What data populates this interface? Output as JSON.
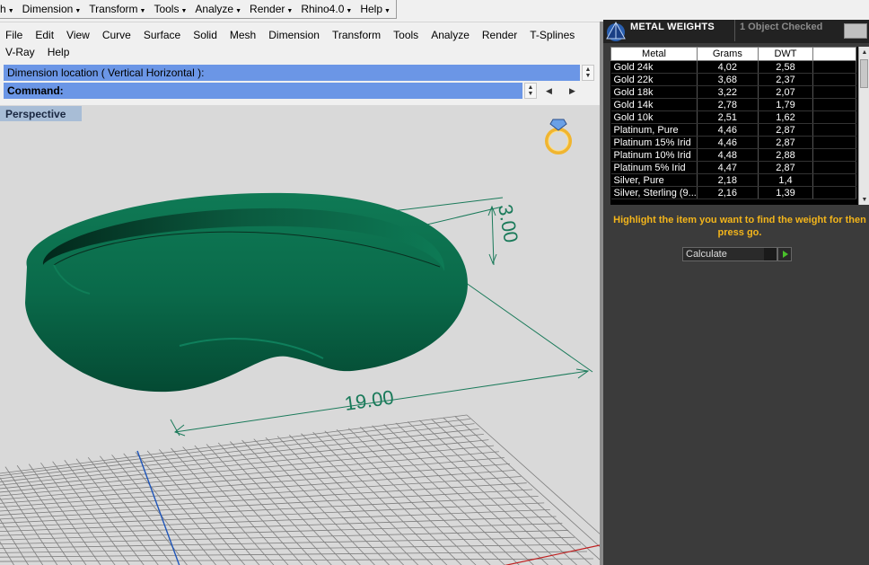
{
  "toolbar": {
    "items": [
      {
        "label": "h"
      },
      {
        "label": "Dimension"
      },
      {
        "label": "Transform"
      },
      {
        "label": "Tools"
      },
      {
        "label": "Analyze"
      },
      {
        "label": "Render"
      },
      {
        "label": "Rhino4.0"
      },
      {
        "label": "Help"
      }
    ]
  },
  "menubar": {
    "row1": [
      "File",
      "Edit",
      "View",
      "Curve",
      "Surface",
      "Solid",
      "Mesh",
      "Dimension",
      "Transform",
      "Tools",
      "Analyze",
      "Render",
      "T-Splines"
    ],
    "row2": [
      "V-Ray",
      "Help"
    ]
  },
  "command": {
    "history": "Dimension location ( Vertical  Horizontal ):",
    "prompt": "Command:"
  },
  "viewport": {
    "label": "Perspective",
    "dimension_height": "3.00",
    "dimension_width": "19.00",
    "colors": {
      "background": "#d9d9d9",
      "ring": "#0e6e4e",
      "dimension": "#1a7a5a",
      "grid": "#8a8a8a",
      "axis": "#1e54b8"
    }
  },
  "metal_weights": {
    "title": "METAL WEIGHTS",
    "status": "1 Object Checked",
    "columns": [
      "Metal",
      "Grams",
      "DWT"
    ],
    "rows": [
      {
        "metal": "Gold 24k",
        "grams": "4,02",
        "dwt": "2,58"
      },
      {
        "metal": "Gold 22k",
        "grams": "3,68",
        "dwt": "2,37"
      },
      {
        "metal": "Gold 18k",
        "grams": "3,22",
        "dwt": "2,07"
      },
      {
        "metal": "Gold 14k",
        "grams": "2,78",
        "dwt": "1,79"
      },
      {
        "metal": "Gold 10k",
        "grams": "2,51",
        "dwt": "1,62"
      },
      {
        "metal": "Platinum, Pure",
        "grams": "4,46",
        "dwt": "2,87"
      },
      {
        "metal": "Platinum 15% Irid",
        "grams": "4,46",
        "dwt": "2,87"
      },
      {
        "metal": "Platinum 10% Irid",
        "grams": "4,48",
        "dwt": "2,88"
      },
      {
        "metal": "Platinum 5% Irid",
        "grams": "4,47",
        "dwt": "2,87"
      },
      {
        "metal": "Silver, Pure",
        "grams": "2,18",
        "dwt": "1,4"
      },
      {
        "metal": "Silver, Sterling (9...",
        "grams": "2,16",
        "dwt": "1,39"
      }
    ],
    "instruction": "Highlight the item you want to find the weight for then press go.",
    "calc_select_value": "Calculate",
    "accent_color": "#f3b51b"
  }
}
